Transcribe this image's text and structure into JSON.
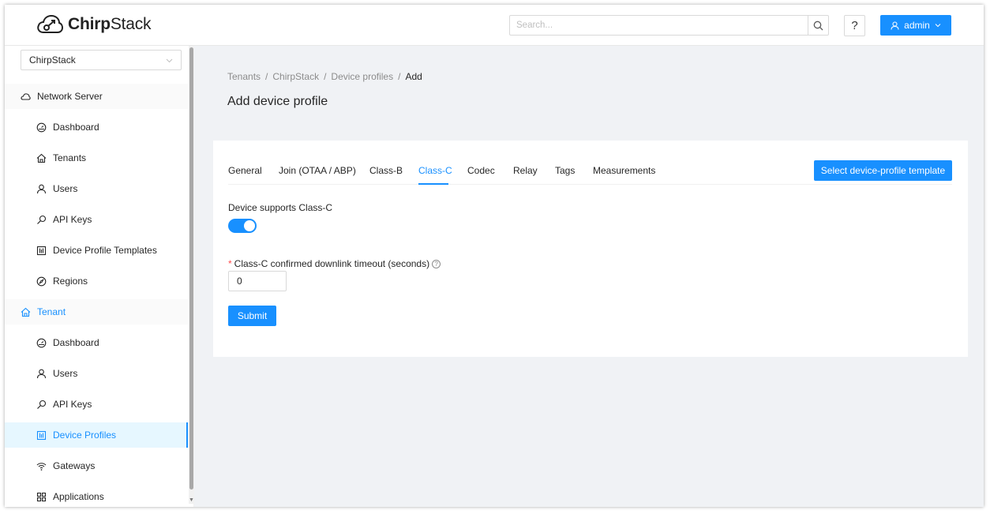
{
  "header": {
    "logo_text_bold": "Chirp",
    "logo_text_regular": "Stack",
    "search_placeholder": "Search...",
    "help_label": "?",
    "user_label": "admin"
  },
  "sidebar": {
    "tenant_select_value": "ChirpStack",
    "network_server_label": "Network Server",
    "network_items": [
      {
        "label": "Dashboard",
        "icon": "dashboard-icon"
      },
      {
        "label": "Tenants",
        "icon": "home-icon"
      },
      {
        "label": "Users",
        "icon": "user-icon"
      },
      {
        "label": "API Keys",
        "icon": "key-icon"
      },
      {
        "label": "Device Profile Templates",
        "icon": "template-icon"
      },
      {
        "label": "Regions",
        "icon": "compass-icon"
      }
    ],
    "tenant_label": "Tenant",
    "tenant_items": [
      {
        "label": "Dashboard",
        "icon": "dashboard-icon"
      },
      {
        "label": "Users",
        "icon": "user-icon"
      },
      {
        "label": "API Keys",
        "icon": "key-icon"
      },
      {
        "label": "Device Profiles",
        "icon": "template-icon"
      },
      {
        "label": "Gateways",
        "icon": "wifi-icon"
      },
      {
        "label": "Applications",
        "icon": "apps-icon"
      }
    ]
  },
  "breadcrumb": [
    "Tenants",
    "ChirpStack",
    "Device profiles",
    "Add"
  ],
  "page_title": "Add device profile",
  "tabs": [
    "General",
    "Join (OTAA / ABP)",
    "Class-B",
    "Class-C",
    "Codec",
    "Relay",
    "Tags",
    "Measurements"
  ],
  "active_tab": "Class-C",
  "template_button": "Select device-profile template",
  "form": {
    "supports_label": "Device supports Class-C",
    "supports_enabled": true,
    "timeout_label": "Class-C confirmed downlink timeout (seconds)",
    "timeout_value": "0",
    "submit_label": "Submit"
  },
  "colors": {
    "accent": "#1890ff",
    "required": "#ff4d4f"
  }
}
